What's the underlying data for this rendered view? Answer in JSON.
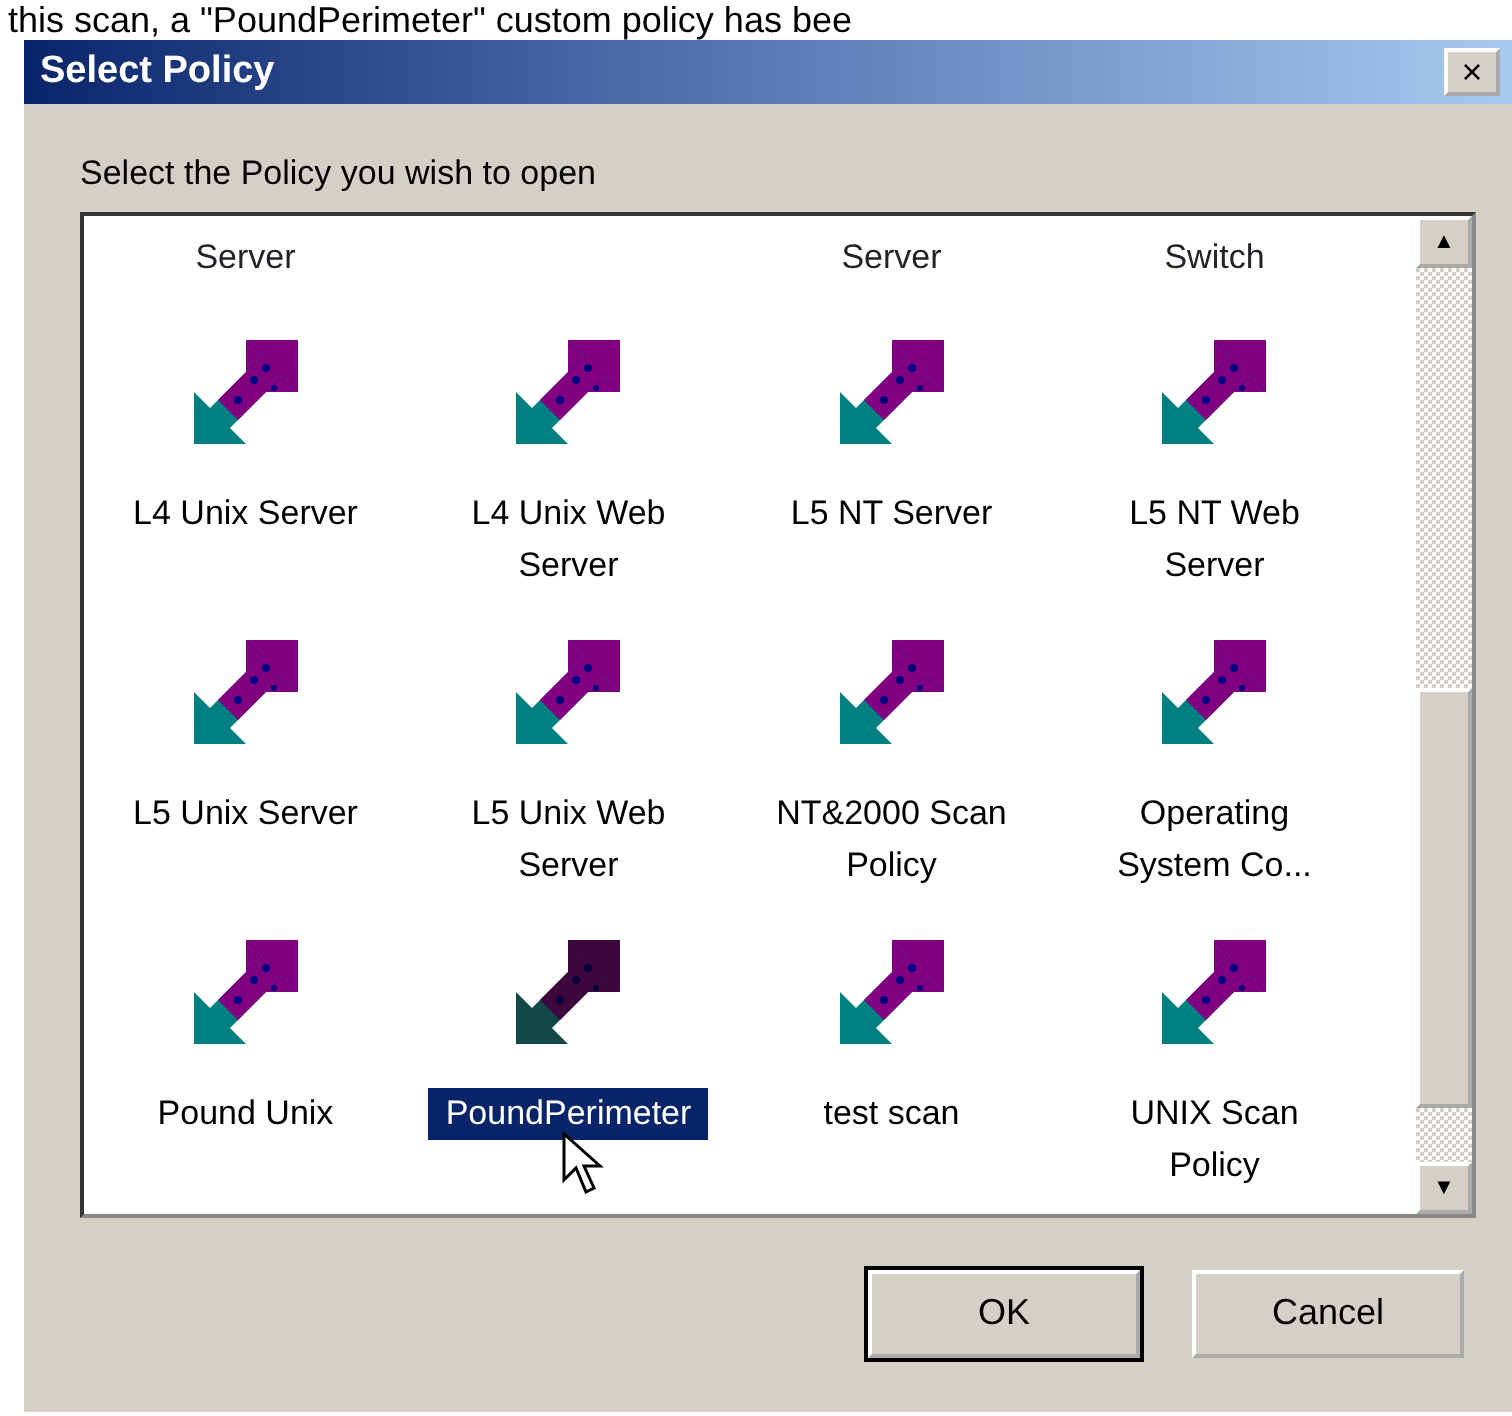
{
  "caption": "this scan, a \"PoundPerimeter\" custom policy has bee",
  "window": {
    "title": "Select Policy",
    "close": "×"
  },
  "prompt": "Select the Policy you wish to open",
  "cut_row": [
    {
      "kind": "label",
      "label": "Server"
    },
    {
      "kind": "blank"
    },
    {
      "kind": "label",
      "label": "Server"
    },
    {
      "kind": "label",
      "label": "Switch"
    }
  ],
  "policies": [
    {
      "label": "L4 Unix Server",
      "selected": false
    },
    {
      "label": "L4 Unix Web Server",
      "selected": false
    },
    {
      "label": "L5 NT Server",
      "selected": false
    },
    {
      "label": "L5 NT Web Server",
      "selected": false
    },
    {
      "label": "L5 Unix Server",
      "selected": false
    },
    {
      "label": "L5 Unix Web Server",
      "selected": false
    },
    {
      "label": "NT&2000 Scan Policy",
      "selected": false
    },
    {
      "label": "Operating System Co...",
      "selected": false
    },
    {
      "label": "Pound Unix",
      "selected": false
    },
    {
      "label": "PoundPerimeter",
      "selected": true
    },
    {
      "label": "test scan",
      "selected": false
    },
    {
      "label": "UNIX Scan Policy",
      "selected": false
    }
  ],
  "scroll": {
    "up": "▲",
    "down": "▼"
  },
  "buttons": [
    "OK",
    "Cancel"
  ]
}
